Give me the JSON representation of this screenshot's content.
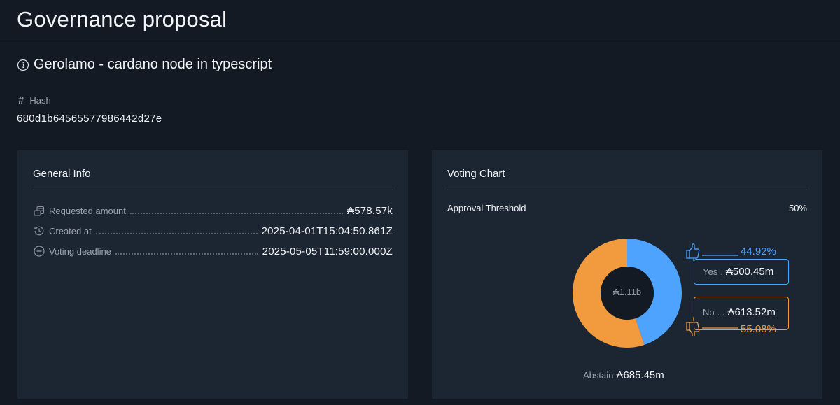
{
  "page": {
    "title": "Governance proposal"
  },
  "proposal": {
    "name": "Gerolamo - cardano node in typescript",
    "hash_label": "Hash",
    "hash_value": "680d1b64565577986442d27e"
  },
  "general_info": {
    "title": "General Info",
    "rows": [
      {
        "icon": "coins-icon",
        "label": "Requested amount",
        "value": "₳578.57k"
      },
      {
        "icon": "history-icon",
        "label": "Created at",
        "value": "2025-04-01T15:04:50.861Z"
      },
      {
        "icon": "minus-circle-icon",
        "label": "Voting deadline",
        "value": "2025-05-05T11:59:00.000Z"
      }
    ]
  },
  "voting_chart": {
    "title": "Voting Chart",
    "threshold_label": "Approval Threshold",
    "threshold_value": "50%",
    "center_total": "₳1.11b",
    "yes": {
      "label": "Yes",
      "value": "₳500.45m",
      "percent": "44.92%"
    },
    "no": {
      "label": "No",
      "value": "₳613.52m",
      "percent": "55.08%"
    },
    "abstain": {
      "label": "Abstain",
      "value": "₳685.45m"
    },
    "colors": {
      "yes": "#4da3ff",
      "no": "#f19a3e"
    }
  },
  "chart_data": {
    "type": "pie",
    "categories": [
      "Yes",
      "No"
    ],
    "values": [
      44.92,
      55.08
    ]
  }
}
